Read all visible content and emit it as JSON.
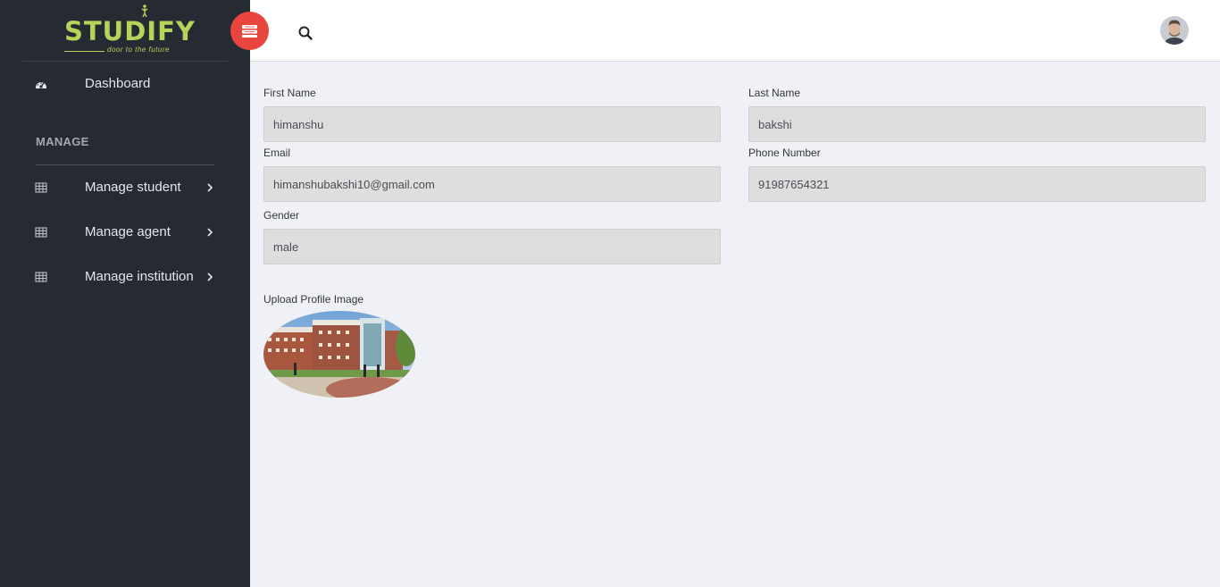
{
  "brand": {
    "name": "STUDIFY",
    "tagline": "door to the future",
    "accent": "#b6d35a"
  },
  "sidebar": {
    "dashboard": {
      "label": "Dashboard",
      "icon": "dashboard-icon"
    },
    "section_title": "MANAGE",
    "items": [
      {
        "label": "Manage student",
        "icon": "table-icon"
      },
      {
        "label": "Manage agent",
        "icon": "table-icon"
      },
      {
        "label": "Manage institution",
        "icon": "table-icon"
      }
    ]
  },
  "topbar": {
    "toggle_icon": "menu-toggle-icon",
    "toggle_color": "#e8453c",
    "search_icon": "search-icon",
    "avatar_icon": "user-avatar"
  },
  "form": {
    "first_name": {
      "label": "First Name",
      "value": "himanshu"
    },
    "last_name": {
      "label": "Last Name",
      "value": "bakshi"
    },
    "email": {
      "label": "Email",
      "value": "himanshubakshi10@gmail.com"
    },
    "phone": {
      "label": "Phone Number",
      "value": "91987654321"
    },
    "gender": {
      "label": "Gender",
      "value": "male"
    },
    "upload": {
      "label": "Upload Profile Image"
    }
  }
}
